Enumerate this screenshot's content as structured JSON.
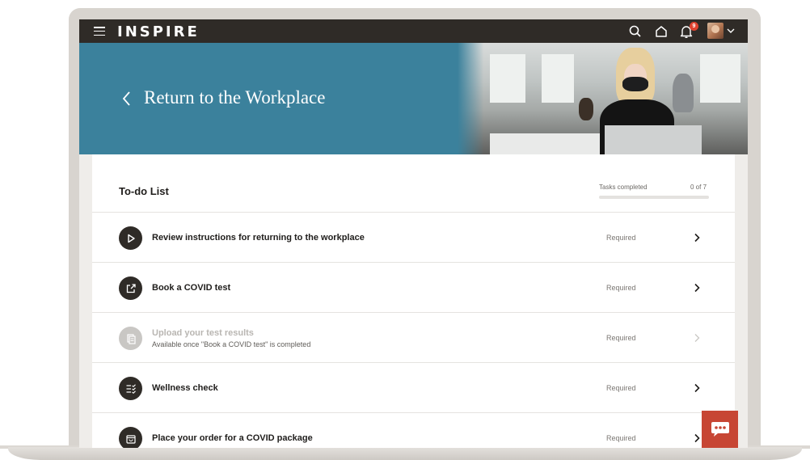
{
  "app": {
    "logo_text": "INSPIRE",
    "notification_count": "9"
  },
  "hero": {
    "title": "Return to the Workplace"
  },
  "todo": {
    "title": "To-do List",
    "tasks_completed_label": "Tasks completed",
    "tasks_completed_count": "0 of 7",
    "progress_fraction": 0,
    "items": [
      {
        "title": "Review instructions for returning to the workplace",
        "subtitle": "",
        "status": "Required",
        "icon": "play-icon",
        "enabled": true
      },
      {
        "title": "Book a COVID test",
        "subtitle": "",
        "status": "Required",
        "icon": "external-link-icon",
        "enabled": true
      },
      {
        "title": "Upload your test results",
        "subtitle": "Available once \"Book a COVID test\" is completed",
        "status": "Required",
        "icon": "document-upload-icon",
        "enabled": false
      },
      {
        "title": "Wellness check",
        "subtitle": "",
        "status": "Required",
        "icon": "checklist-icon",
        "enabled": true
      },
      {
        "title": "Place your order for a COVID package",
        "subtitle": "",
        "status": "Required",
        "icon": "shopping-bag-icon",
        "enabled": true
      }
    ]
  },
  "colors": {
    "topbar": "#2f2b27",
    "hero": "#3b819c",
    "badge": "#e0422f",
    "chat": "#c74634"
  }
}
